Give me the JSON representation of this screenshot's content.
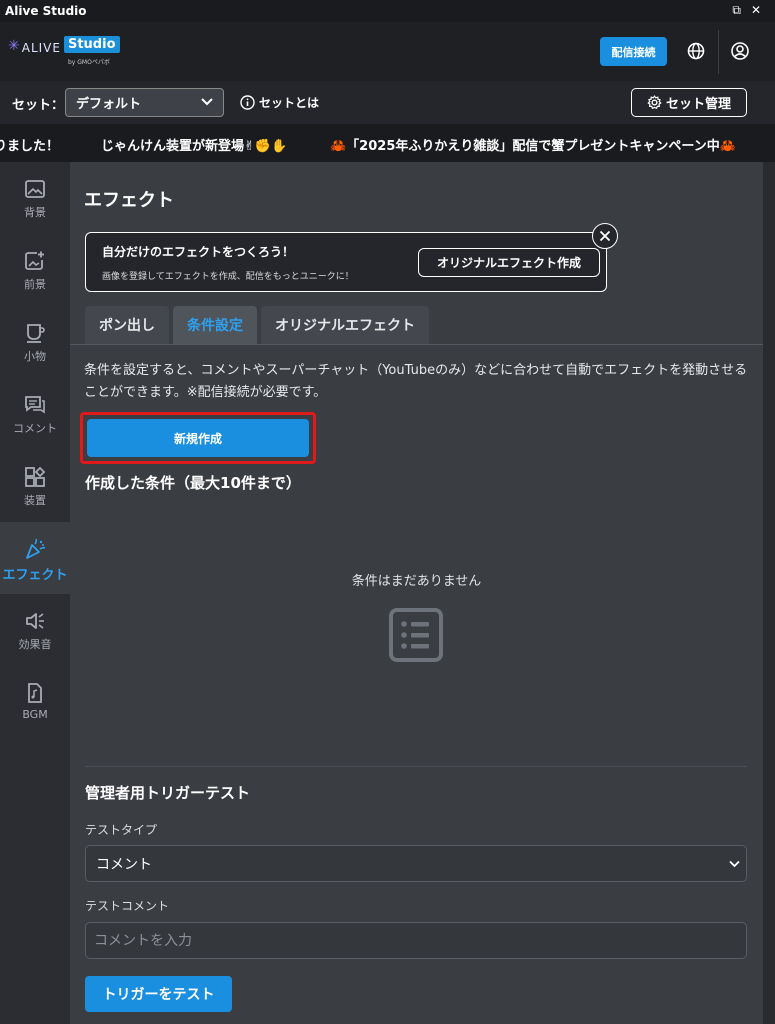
{
  "window": {
    "title": "Alive Studio"
  },
  "header": {
    "logo_alive": "ALIVE",
    "logo_studio": "Studio",
    "logo_by": "by GMOペパボ",
    "connect_label": "配信接続"
  },
  "setbar": {
    "label": "セット：",
    "selected": "デフォルト",
    "help": "セットとは",
    "manage": "セット管理"
  },
  "ticker": [
    "りました！",
    "じゃんけん装置が新登場✌✊✋",
    "🦀「2025年ふりかえり雑談」配信で蟹プレゼントキャンペーン中🦀"
  ],
  "sidebar": {
    "items": [
      {
        "label": "背景",
        "icon": "image-icon"
      },
      {
        "label": "前景",
        "icon": "image-plus-icon"
      },
      {
        "label": "小物",
        "icon": "cup-icon"
      },
      {
        "label": "コメント",
        "icon": "comment-icon"
      },
      {
        "label": "装置",
        "icon": "device-icon"
      },
      {
        "label": "エフェクト",
        "icon": "party-popper-icon"
      },
      {
        "label": "効果音",
        "icon": "speaker-icon"
      },
      {
        "label": "BGM",
        "icon": "music-file-icon"
      }
    ],
    "active_index": 5
  },
  "main": {
    "title": "エフェクト",
    "promo": {
      "title": "自分だけのエフェクトをつくろう！",
      "subtitle": "画像を登録してエフェクトを作成、配信をもっとユニークに！",
      "button": "オリジナルエフェクト作成"
    },
    "tabs": [
      {
        "label": "ポン出し"
      },
      {
        "label": "条件設定"
      },
      {
        "label": "オリジナルエフェクト"
      }
    ],
    "active_tab": 1,
    "description": "条件を設定すると、コメントやスーパーチャット（YouTubeのみ）などに合わせて自動でエフェクトを発動させることができます。※配信接続が必要です。",
    "new_button": "新規作成",
    "conditions_title": "作成した条件（最大10件まで）",
    "empty_text": "条件はまだありません",
    "admin": {
      "title": "管理者用トリガーテスト",
      "type_label": "テストタイプ",
      "type_value": "コメント",
      "comment_label": "テストコメント",
      "comment_placeholder": "コメントを入力",
      "test_button": "トリガーをテスト"
    }
  },
  "colors": {
    "accent": "#1a8fe0",
    "active_text": "#2ea0f0",
    "highlight": "#e01a1a"
  }
}
